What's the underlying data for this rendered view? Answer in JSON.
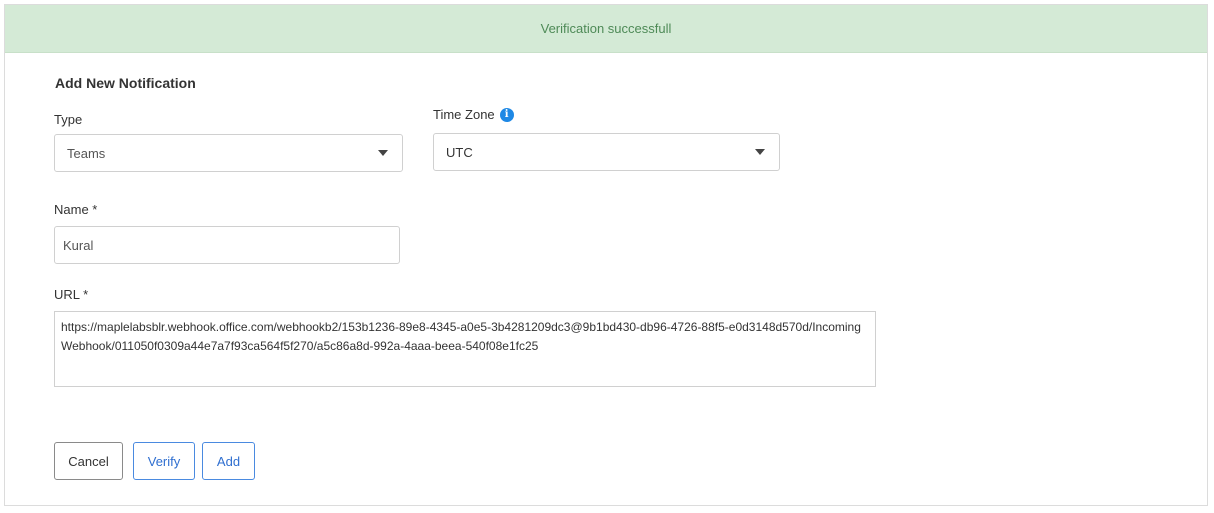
{
  "banner": {
    "message": "Verification successfull"
  },
  "form": {
    "title": "Add New Notification",
    "type": {
      "label": "Type",
      "value": "Teams"
    },
    "timezone": {
      "label": "Time Zone",
      "value": "UTC",
      "info_icon": "info-icon"
    },
    "name": {
      "label": "Name *",
      "value": "Kural"
    },
    "url": {
      "label": "URL *",
      "value": "https://maplelabsblr.webhook.office.com/webhookb2/153b1236-89e8-4345-a0e5-3b4281209dc3@9b1bd430-db96-4726-88f5-e0d3148d570d/IncomingWebhook/011050f0309a44e7a7f93ca564f5f270/a5c86a8d-992a-4aaa-beea-540f08e1fc25"
    }
  },
  "actions": {
    "cancel_label": "Cancel",
    "verify_label": "Verify",
    "add_label": "Add"
  },
  "colors": {
    "banner_bg": "#d4ead6",
    "banner_text": "#4e8a57",
    "primary": "#2f6fd0",
    "info_icon": "#1e88e5"
  }
}
